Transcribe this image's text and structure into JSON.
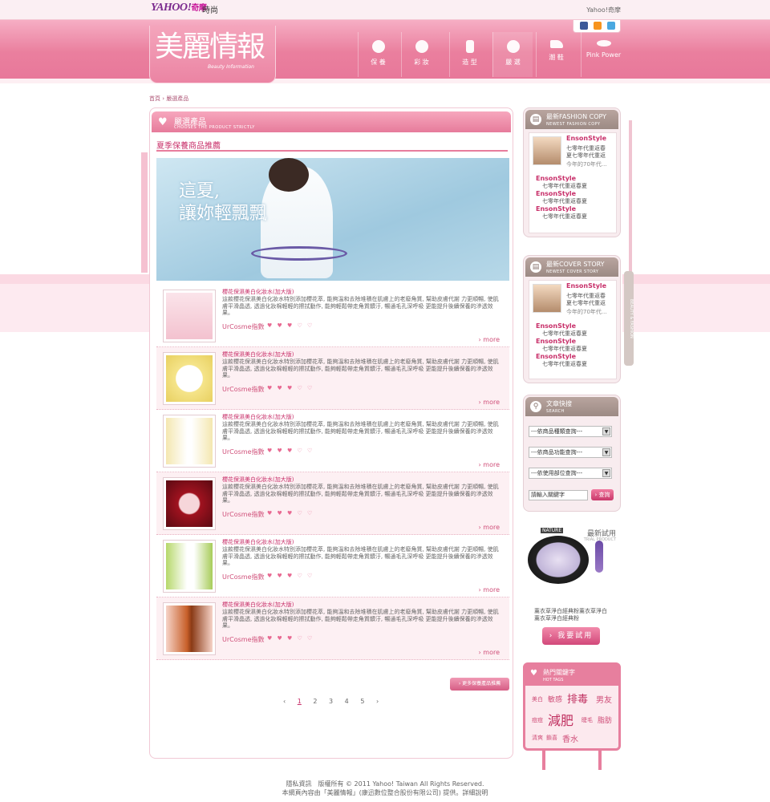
{
  "topbar": {
    "logo": "YAHOO!",
    "logo_sub": "奇摩",
    "site": "時尚",
    "link": "Yahoo!奇摩"
  },
  "brand": {
    "title": "美麗情報",
    "subtitle": "Beauty Information"
  },
  "nav": [
    {
      "label": "保 養"
    },
    {
      "label": "彩 妝"
    },
    {
      "label": "造 型"
    },
    {
      "label": "嚴 選"
    },
    {
      "label": "潮 鞋"
    },
    {
      "label": "Pink Power"
    }
  ],
  "breadcrumb": "首頁 › 嚴選產品",
  "section": {
    "title": "嚴選產品",
    "subtitle": "CHOOSES THE PRODUCT STRICTLY"
  },
  "subtitle": "夏季保養商品推薦",
  "banner_text": [
    "這夏,",
    "讓妳輕飄飄"
  ],
  "products": [
    {
      "title": "櫻花保濕美白化妝水(加大版)",
      "desc": "這款櫻花保濕美白化妝水特別添加櫻花萃, 能夠溫和去除堆積在肌膚上的老廢角質, 幫助皮膚代謝 力更順暢, 使肌膚平滑晶透, 透過化妝棉輕輕的擦拭動作, 能夠輕鬆帶走角質髒汙, 暢通毛孔深呼吸 更能提升後續保養的滲透效果。",
      "source": "UrCosme指數",
      "hearts": "♥ ♥ ♥ ♡ ♡",
      "more": "› more"
    },
    {
      "title": "櫻花保濕美白化妝水(加大版)",
      "desc": "這款櫻花保濕美白化妝水特別添加櫻花萃, 能夠溫和去除堆積在肌膚上的老廢角質, 幫助皮膚代謝 力更順暢, 使肌膚平滑晶透, 透過化妝棉輕輕的擦拭動作, 能夠輕鬆帶走角質髒汙, 暢通毛孔深呼吸 更能提升後續保養的滲透效果。",
      "source": "UrCosme指數",
      "hearts": "♥ ♥ ♥ ♡ ♡",
      "more": "› more"
    },
    {
      "title": "櫻花保濕美白化妝水(加大版)",
      "desc": "這款櫻花保濕美白化妝水特別添加櫻花萃, 能夠溫和去除堆積在肌膚上的老廢角質, 幫助皮膚代謝 力更順暢, 使肌膚平滑晶透, 透過化妝棉輕輕的擦拭動作, 能夠輕鬆帶走角質髒汙, 暢通毛孔深呼吸 更能提升後續保養的滲透效果。",
      "source": "UrCosme指數",
      "hearts": "♥ ♥ ♥ ♡ ♡",
      "more": "› more"
    },
    {
      "title": "櫻花保濕美白化妝水(加大版)",
      "desc": "這款櫻花保濕美白化妝水特別添加櫻花萃, 能夠溫和去除堆積在肌膚上的老廢角質, 幫助皮膚代謝 力更順暢, 使肌膚平滑晶透, 透過化妝棉輕輕的擦拭動作, 能夠輕鬆帶走角質髒汙, 暢通毛孔深呼吸 更能提升後續保養的滲透效果。",
      "source": "UrCosme指數",
      "hearts": "♥ ♥ ♥ ♡ ♡",
      "more": "› more"
    },
    {
      "title": "櫻花保濕美白化妝水(加大版)",
      "desc": "這款櫻花保濕美白化妝水特別添加櫻花萃, 能夠溫和去除堆積在肌膚上的老廢角質, 幫助皮膚代謝 力更順暢, 使肌膚平滑晶透, 透過化妝棉輕輕的擦拭動作, 能夠輕鬆帶走角質髒汙, 暢通毛孔深呼吸 更能提升後續保養的滲透效果。",
      "source": "UrCosme指數",
      "hearts": "♥ ♥ ♥ ♡ ♡",
      "more": "› more"
    },
    {
      "title": "櫻花保濕美白化妝水(加大版)",
      "desc": "這款櫻花保濕美白化妝水特別添加櫻花萃, 能夠溫和去除堆積在肌膚上的老廢角質, 幫助皮膚代謝 力更順暢, 使肌膚平滑晶透, 透過化妝棉輕輕的擦拭動作, 能夠輕鬆帶走角質髒汙, 暢通毛孔深呼吸 更能提升後續保養的滲透效果。",
      "source": "UrCosme指數",
      "hearts": "♥ ♥ ♥ ♡ ♡",
      "more": "› more"
    }
  ],
  "more_button": "› 更多保養產品推薦",
  "pager": [
    "‹",
    "1",
    "2",
    "3",
    "4",
    "5",
    "›"
  ],
  "fashion_copy": {
    "title": "最新FASHION COPY",
    "subtitle": "NEWEST FASHION COPY",
    "feature": {
      "name": "EnsonStyle",
      "lines": [
        "七零年代重返春",
        "夏七零年代重返",
        "今年的70年代..."
      ]
    },
    "list": [
      {
        "name": "EnsonStyle",
        "text": "七零年代重返春夏"
      },
      {
        "name": "EnsonStyle",
        "text": "七零年代重返春夏"
      },
      {
        "name": "EnsonStyle",
        "text": "七零年代重返春夏"
      }
    ]
  },
  "cover_story": {
    "title": "最新COVER STORY",
    "subtitle": "NEWEST COVER STORY",
    "feature": {
      "name": "EnsonStyle",
      "lines": [
        "七零年代重返春",
        "夏七零年代重返",
        "今年的70年代..."
      ]
    },
    "list": [
      {
        "name": "EnsonStyle",
        "text": "七零年代重返春夏"
      },
      {
        "name": "EnsonStyle",
        "text": "七零年代重返春夏"
      },
      {
        "name": "EnsonStyle",
        "text": "七零年代重返春夏"
      }
    ]
  },
  "search": {
    "title": "文章快搜",
    "subtitle": "SEARCH",
    "selects": [
      "---依商品種類查詢---",
      "---依商品功能查詢---",
      "---依使用部位查詢---"
    ],
    "keyword_value": "請輸入關鍵字",
    "button": "› 查詢"
  },
  "trial": {
    "title": "最新試用",
    "subtitle": "TRIAL PRODUCT",
    "brand": "NATURE",
    "desc": [
      "薰衣草淨白經典粉薰衣草淨白",
      "薰衣草淨白經典粉"
    ],
    "button": "› 我要試用"
  },
  "hot_tags": {
    "title": "熱門關鍵字",
    "subtitle": "HOT TAGS",
    "tags": [
      "美白",
      "敏感",
      "排毒",
      "男友",
      "痘痘",
      "減肥",
      "睫毛",
      "脂肪",
      "清爽",
      "鎖喜",
      "香水"
    ]
  },
  "side_vertical": "BEAUTY & FASHION",
  "footer": {
    "line1": "隱私資訊　版權所有 © 2011 Yahoo! Taiwan All Rights Reserved.",
    "line2": "本網頁內容由「美麗情報」(康迅數位整合股份有限公司) 提供。詳細說明"
  }
}
